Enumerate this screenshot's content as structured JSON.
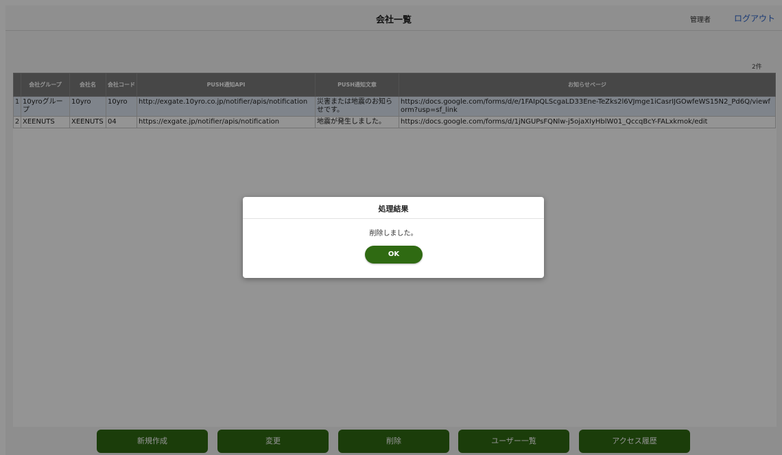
{
  "header": {
    "title": "会社一覧",
    "role": "管理者",
    "logout_label": "ログアウト"
  },
  "list": {
    "count_label": "2件",
    "columns": [
      "",
      "会社グループ",
      "会社名",
      "会社コード",
      "PUSH通知API",
      "PUSH通知文章",
      "お知らせページ"
    ],
    "rows": [
      [
        "1",
        "10yroグループ",
        "10yro",
        "10yro",
        "http://exgate.10yro.co.jp/notifier/apis/notification",
        "災害または地震のお知らせです。",
        "https://docs.google.com/forms/d/e/1FAIpQLScgaLD33Ene-TeZks2l6VJmge1iCasrIJGOwfeWS15N2_Pd6Q/viewform?usp=sf_link"
      ],
      [
        "2",
        "XEENUTS",
        "XEENUTS",
        "04",
        "https://exgate.jp/notifier/apis/notification",
        "地震が発生しました。",
        "https://docs.google.com/forms/d/1jNGUPsFQNlw-j5ojaXIyHblW01_QccqBcY-FALxkmok/edit"
      ]
    ]
  },
  "footer": {
    "new_label": "新規作成",
    "edit_label": "変更",
    "delete_label": "削除",
    "users_label": "ユーザー一覧",
    "history_label": "アクセス履歴"
  },
  "dialog": {
    "title": "処理結果",
    "message": "削除しました。",
    "ok_label": "OK"
  },
  "colors": {
    "primary_green": "#2f6a12",
    "table_header": "#7a7a7a",
    "selected_row": "#dbe4ef",
    "link_blue": "#2a62c9"
  }
}
